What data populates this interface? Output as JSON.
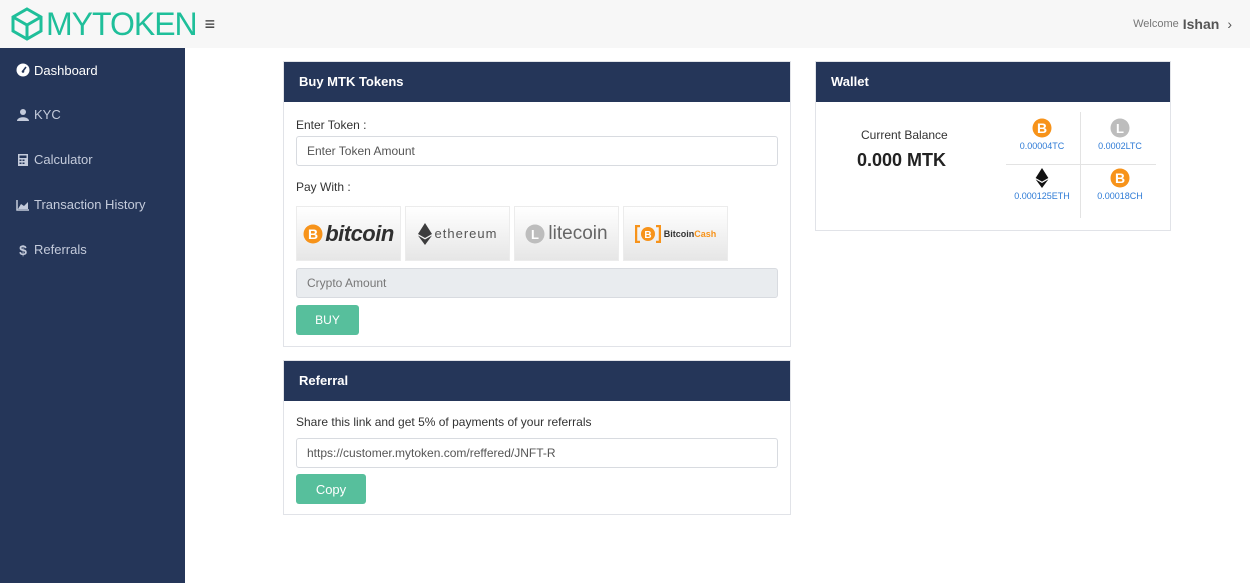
{
  "app": {
    "logo_text": "MYTOKEN",
    "welcome_text": "Welcome",
    "username": "Ishan"
  },
  "sidebar": {
    "items": [
      {
        "label": "Dashboard",
        "icon": "dashboard-icon",
        "active": true
      },
      {
        "label": "KYC",
        "icon": "user-icon",
        "active": false
      },
      {
        "label": "Calculator",
        "icon": "calculator-icon",
        "active": false
      },
      {
        "label": "Transaction History",
        "icon": "area-chart-icon",
        "active": false
      },
      {
        "label": "Referrals",
        "icon": "dollar-icon",
        "active": false
      }
    ]
  },
  "buy": {
    "title": "Buy MTK Tokens",
    "token_label": "Enter Token :",
    "token_placeholder": "Enter Token Amount",
    "pay_with_label": "Pay With :",
    "coins": [
      {
        "label": "bitcoin",
        "icon": "bitcoin-icon"
      },
      {
        "label": "ethereum",
        "icon": "ethereum-icon"
      },
      {
        "label": "litecoin",
        "icon": "litecoin-icon"
      },
      {
        "label_a": "Bitcoin",
        "label_b": "Cash",
        "icon": "bitcoin-cash-icon"
      }
    ],
    "crypto_placeholder": "Crypto Amount",
    "buy_button": "BUY"
  },
  "referral": {
    "title": "Referral",
    "description": "Share this link and get 5% of payments of your referrals",
    "link": "https://customer.mytoken.com/reffered/JNFT-R",
    "copy_button": "Copy"
  },
  "wallet": {
    "title": "Wallet",
    "balance_label": "Current Balance",
    "balance_value": "0.000 MTK",
    "assets": [
      {
        "value": "0.00004TC",
        "icon": "bitcoin-icon"
      },
      {
        "value": "0.0002LTC",
        "icon": "litecoin-icon"
      },
      {
        "value": "0.000125ETH",
        "icon": "ethereum-icon"
      },
      {
        "value": "0.00018CH",
        "icon": "bitcoin-cash-icon"
      }
    ]
  },
  "colors": {
    "sidebar_bg": "#253659",
    "accent": "#57bf9c",
    "logo": "#1fbf9a",
    "bitcoin": "#f7931a",
    "link": "#2e7bd6"
  }
}
